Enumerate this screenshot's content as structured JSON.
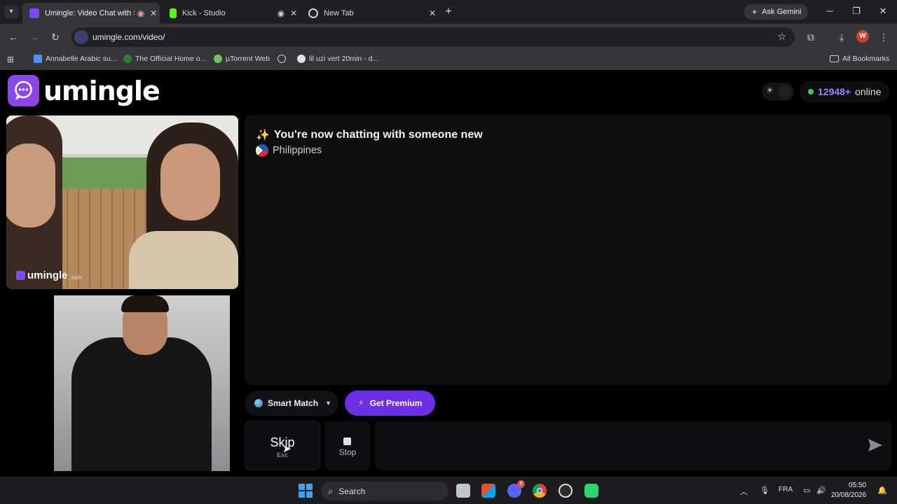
{
  "browser": {
    "tabs": [
      {
        "title": "Umingle: Video Chat with St",
        "active": true
      },
      {
        "title": "Kick - Studio",
        "active": false
      },
      {
        "title": "New Tab",
        "active": false
      }
    ],
    "ask_gemini": "Ask Gemini",
    "url": "umingle.com/video/",
    "profile_initial": "W",
    "bookmarks": [
      "Annabelle Arabic su...",
      "The Official Home o...",
      "µTorrent Web",
      "lil uzi vert 20min - d..."
    ],
    "all_bookmarks": "All Bookmarks"
  },
  "site": {
    "logo_text": "umingle",
    "online_count": "12948+",
    "online_label": "online",
    "watermark_text": "umingle",
    "watermark_suffix": ".com"
  },
  "chat": {
    "title_emoji": "✨",
    "title": "You're now chatting with someone new",
    "country": "Philippines"
  },
  "controls": {
    "smart_match": "Smart Match",
    "get_premium": "Get Premium",
    "skip": "Skip",
    "skip_hint": "Esc",
    "stop": "Stop",
    "message_value": ""
  },
  "taskbar": {
    "search": "Search",
    "language": "FRA",
    "time": "05:50",
    "date": "20/08/2026",
    "discord_badge": "5"
  },
  "colors": {
    "accent": "#6d2fe6",
    "online_count": "#a47cff",
    "online_dot": "#3ccf4e"
  }
}
